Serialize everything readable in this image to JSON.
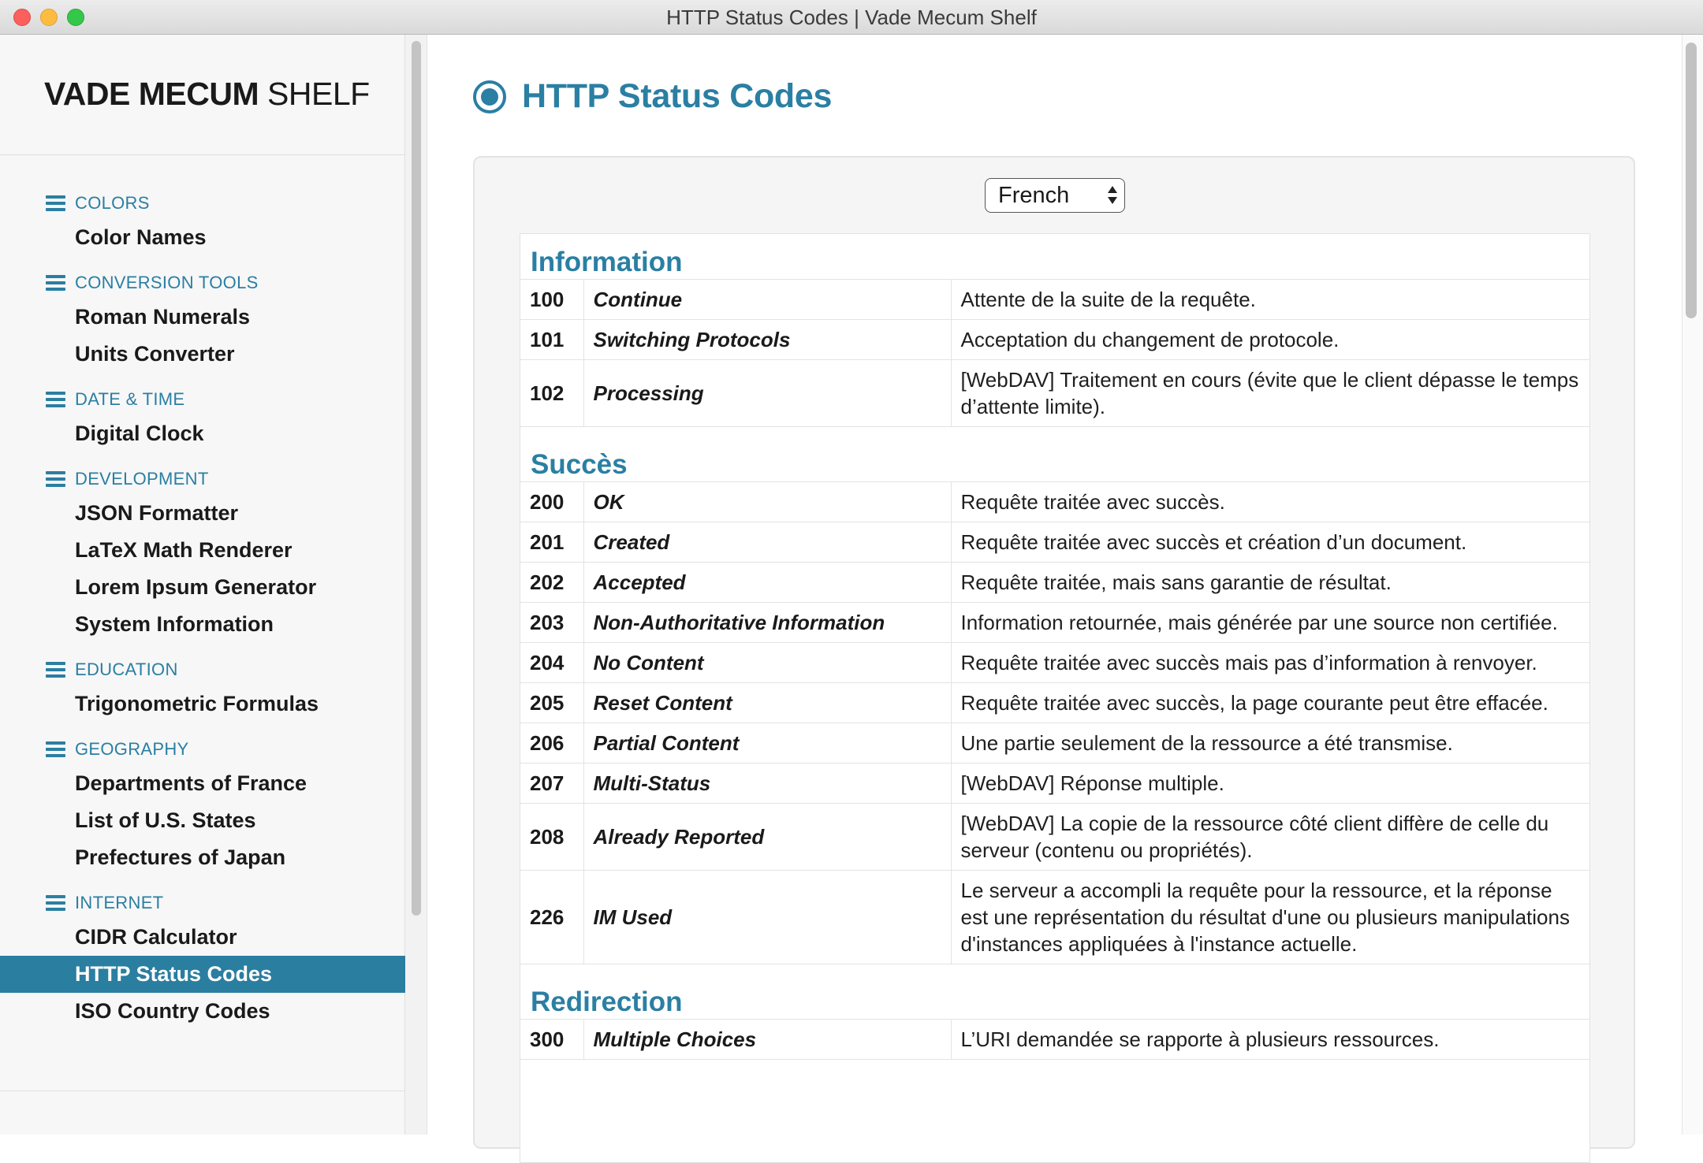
{
  "window": {
    "title": "HTTP Status Codes | Vade Mecum Shelf"
  },
  "brand": {
    "bold": "VADE MECUM",
    "light": "SHELF"
  },
  "sidebar": {
    "groups": [
      {
        "heading": "COLORS",
        "items": [
          "Color Names"
        ]
      },
      {
        "heading": "CONVERSION TOOLS",
        "items": [
          "Roman Numerals",
          "Units Converter"
        ]
      },
      {
        "heading": "DATE & TIME",
        "items": [
          "Digital Clock"
        ]
      },
      {
        "heading": "DEVELOPMENT",
        "items": [
          "JSON Formatter",
          "LaTeX Math Renderer",
          "Lorem Ipsum Generator",
          "System Information"
        ]
      },
      {
        "heading": "EDUCATION",
        "items": [
          "Trigonometric Formulas"
        ]
      },
      {
        "heading": "GEOGRAPHY",
        "items": [
          "Departments of France",
          "List of U.S. States",
          "Prefectures of Japan"
        ]
      },
      {
        "heading": "INTERNET",
        "items": [
          "CIDR Calculator",
          "HTTP Status Codes",
          "ISO Country Codes"
        ]
      }
    ],
    "active_item": "HTTP Status Codes"
  },
  "main": {
    "title": "HTTP Status Codes",
    "language_select": {
      "value": "French"
    },
    "sections": [
      {
        "title": "Information",
        "rows": [
          {
            "code": "100",
            "name": "Continue",
            "desc": "Attente de la suite de la requête."
          },
          {
            "code": "101",
            "name": "Switching Protocols",
            "desc": "Acceptation du changement de protocole."
          },
          {
            "code": "102",
            "name": "Processing",
            "desc": "[WebDAV] Traitement en cours (évite que le client dépasse le temps d’attente limite)."
          }
        ]
      },
      {
        "title": "Succès",
        "rows": [
          {
            "code": "200",
            "name": "OK",
            "desc": "Requête traitée avec succès."
          },
          {
            "code": "201",
            "name": "Created",
            "desc": "Requête traitée avec succès et création d’un document."
          },
          {
            "code": "202",
            "name": "Accepted",
            "desc": "Requête traitée, mais sans garantie de résultat."
          },
          {
            "code": "203",
            "name": "Non-Authoritative Information",
            "desc": "Information retournée, mais générée par une source non certifiée."
          },
          {
            "code": "204",
            "name": "No Content",
            "desc": "Requête traitée avec succès mais pas d’information à renvoyer."
          },
          {
            "code": "205",
            "name": "Reset Content",
            "desc": "Requête traitée avec succès, la page courante peut être effacée."
          },
          {
            "code": "206",
            "name": "Partial Content",
            "desc": "Une partie seulement de la ressource a été transmise."
          },
          {
            "code": "207",
            "name": "Multi-Status",
            "desc": "[WebDAV] Réponse multiple."
          },
          {
            "code": "208",
            "name": "Already Reported",
            "desc": "[WebDAV] La copie de la ressource côté client diffère de celle du serveur (contenu ou propriétés)."
          },
          {
            "code": "226",
            "name": "IM Used",
            "desc": "Le serveur a accompli la requête pour la ressource, et la réponse est une représentation du résultat d'une ou plusieurs manipulations d'instances appliquées à l'instance actuelle."
          }
        ]
      },
      {
        "title": "Redirection",
        "rows": [
          {
            "code": "300",
            "name": "Multiple Choices",
            "desc": "L’URI demandée se rapporte à plusieurs ressources."
          }
        ]
      }
    ]
  },
  "colors": {
    "accent": "#2a7fa3",
    "active_bg": "#2a7ea0"
  }
}
